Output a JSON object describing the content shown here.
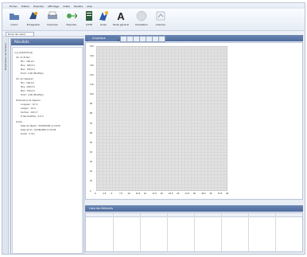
{
  "menu": [
    "Fichier",
    "Edition",
    "Exporter",
    "Affichage",
    "Outils",
    "Fenêtre",
    "Aide"
  ],
  "toolbar": [
    {
      "label": "Ouvrir",
      "icon": "folder-icon"
    },
    {
      "label": "Enregistrer",
      "icon": "save-icon"
    },
    {
      "label": "Imprimer",
      "icon": "printer-icon"
    },
    {
      "label": "Exporter",
      "icon": "export-icon"
    },
    {
      "label": "LISTE",
      "icon": "list-icon"
    },
    {
      "label": "Grille",
      "icon": "grid-icon"
    },
    {
      "label": "Texte général",
      "icon": "text-icon"
    },
    {
      "label": "Simulation",
      "icon": "simulation-icon"
    },
    {
      "label": "Calculer",
      "icon": "calculator-icon"
    }
  ],
  "subtab": "Zone de calcul",
  "sidebar_vertical": "Explorateur de fichiers",
  "results": {
    "title": "Résultats",
    "tree": [
      "C_6_XXXXXXX.zip",
      "Vol. du fichier",
      "Min : 100,0 b",
      "Moy : 200,0 b",
      "Max : 150,0 b",
      "Ecart : 0,00 (Min/Moy)",
      "Vol. de l'appareil",
      "Min : 100,0 b",
      "Moy : 200,0 b",
      "Max : 150,0 b",
      "Ecart : 0,00 (Min/Moy)",
      "Dimensions de l'espace",
      "Longueur : 10 m",
      "Largeur : 10 m",
      "Surface : 100 m²",
      "H des fenêtres : 2,5 m",
      "Durée",
      "Date de départ : 01/06/2009 11:10:00",
      "Date de fin : 01/06/2009 11:15:00",
      "Durée : 4 min"
    ]
  },
  "graph": {
    "title": "Graphique",
    "xticks": [
      "0",
      "2.5",
      "5",
      "7.5",
      "10",
      "12.5",
      "15",
      "17.5",
      "20",
      "22.5",
      "25",
      "27.5",
      "30",
      "32.5",
      "35",
      "37.5",
      "40"
    ],
    "yticks": [
      "0",
      "10",
      "20",
      "30",
      "40",
      "50",
      "60",
      "70",
      "80",
      "90",
      "100",
      "110",
      "120",
      "130",
      "140",
      "150"
    ]
  },
  "list": {
    "title": "Liste des éléments"
  }
}
